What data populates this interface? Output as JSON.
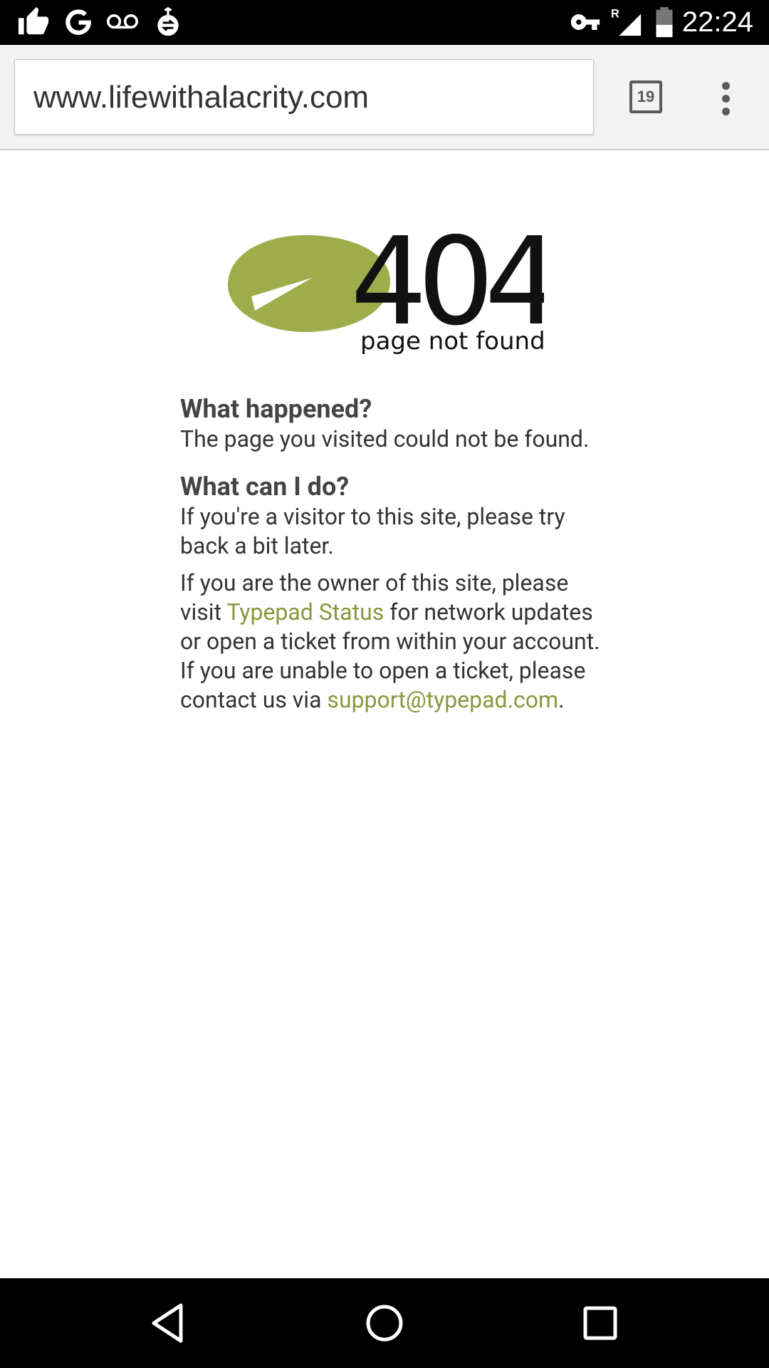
{
  "status_bar": {
    "icons": [
      "thumbs-up-icon",
      "google-icon",
      "voicemail-icon",
      "data-sync-icon",
      "vpn-key-icon",
      "signal-icon",
      "battery-icon"
    ],
    "roaming_indicator": "R",
    "time": "22:24"
  },
  "browser": {
    "url": "www.lifewithalacrity.com",
    "tab_count": "19",
    "menu_icon": "more-vert-icon"
  },
  "page": {
    "logo": {
      "code": "404",
      "caption": "page not found",
      "leaf_color": "#9fac4c"
    },
    "heading_1": "What happened?",
    "text_1": "The page you visited could not be found.",
    "heading_2": "What can I do?",
    "text_2": "If you're a visitor to this site, please try back a bit later.",
    "text_3_before": "If you are the owner of this site, please visit ",
    "status_link": "Typepad Status",
    "text_3_middle": " for network updates or open a ticket from within your account. If you are unable to open a ticket, please contact us via ",
    "support_link": "support@typepad.com",
    "text_3_after": ".",
    "link_color": "#87983e"
  },
  "nav_bar": {
    "buttons": [
      "back-icon",
      "home-icon",
      "recents-icon"
    ]
  }
}
